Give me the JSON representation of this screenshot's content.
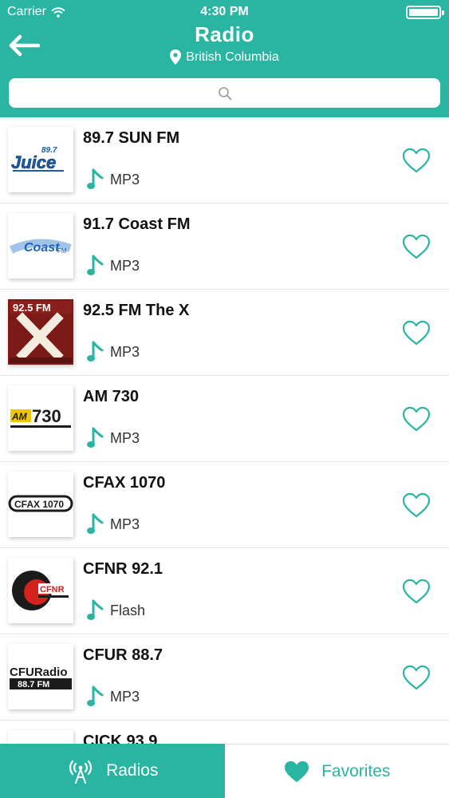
{
  "status_bar": {
    "carrier": "Carrier",
    "time": "4:30 PM"
  },
  "header": {
    "title": "Radio",
    "location": "British Columbia",
    "back_icon": "arrow-left-icon",
    "location_icon": "map-pin-icon"
  },
  "search": {
    "icon": "search-icon"
  },
  "stations": [
    {
      "name": "89.7 SUN FM",
      "format": "MP3",
      "logo_text": "Juice 89.7"
    },
    {
      "name": "91.7 Coast FM",
      "format": "MP3",
      "logo_text": "Coast FM"
    },
    {
      "name": "92.5 FM The X",
      "format": "MP3",
      "logo_text": "92.5 FM"
    },
    {
      "name": "AM 730",
      "format": "MP3",
      "logo_text": "AM730"
    },
    {
      "name": "CFAX 1070",
      "format": "MP3",
      "logo_text": "CFAX 1070"
    },
    {
      "name": "CFNR 92.1",
      "format": "Flash",
      "logo_text": "CFNR"
    },
    {
      "name": "CFUR 88.7",
      "format": "MP3",
      "logo_text": "CFURadio 88.7 FM"
    },
    {
      "name": "CICK 93.9",
      "format": "",
      "logo_text": ""
    }
  ],
  "tabs": [
    {
      "label": "Radios",
      "icon": "radio-tower-icon"
    },
    {
      "label": "Favorites",
      "icon": "heart-icon"
    }
  ],
  "colors": {
    "accent": "#2ab5a3",
    "text": "#111111"
  }
}
